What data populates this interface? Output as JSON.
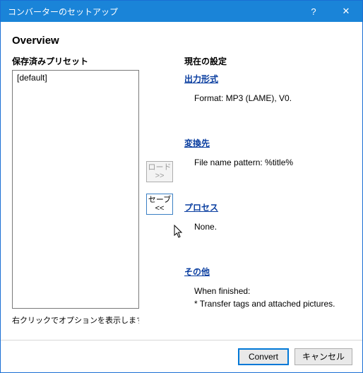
{
  "titlebar": {
    "title": "コンバーターのセットアップ",
    "help": "?",
    "close": "✕"
  },
  "heading": "Overview",
  "left": {
    "label": "保存済みプリセット",
    "items": [
      "[default]"
    ],
    "hint": "右クリックでオプションを表示します"
  },
  "mid": {
    "load_label": "ロード",
    "load_arrows": ">>",
    "save_label": "セーブ",
    "save_arrows": "<<"
  },
  "right": {
    "label": "現在の設定",
    "output": {
      "link": "出力形式",
      "body": "Format: MP3 (LAME), V0."
    },
    "dest": {
      "link": "変換先",
      "body": "File name pattern: %title%"
    },
    "proc": {
      "link": "プロセス",
      "body": "None."
    },
    "other": {
      "link": "その他",
      "body1": "When finished:",
      "body2": "* Transfer tags and attached pictures."
    }
  },
  "footer": {
    "convert": "Convert",
    "cancel": "キャンセル"
  }
}
